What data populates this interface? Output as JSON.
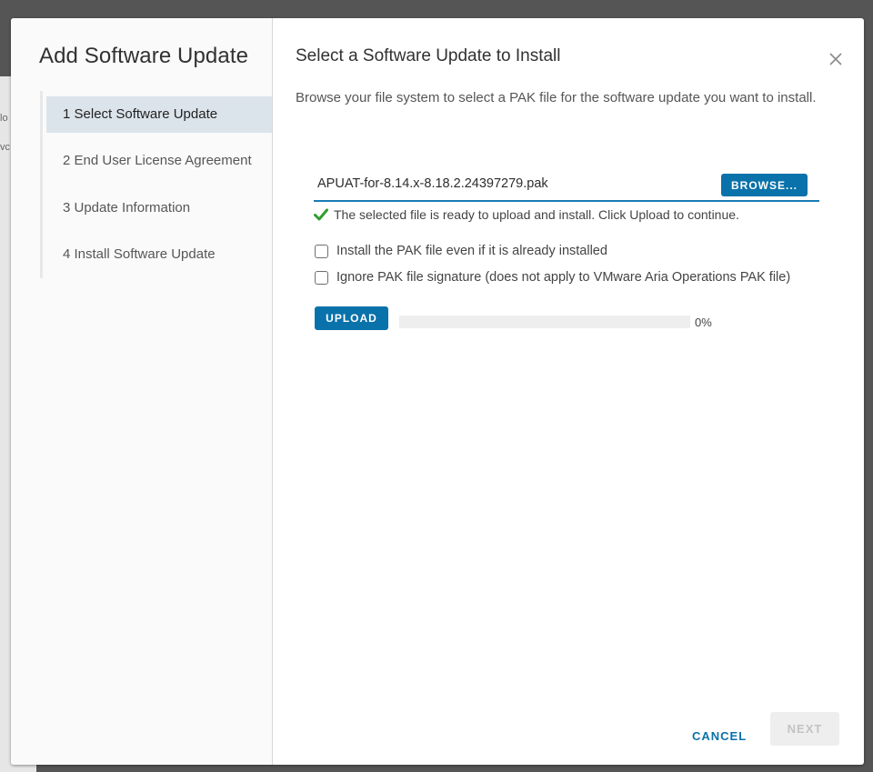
{
  "background": {
    "fragments": [
      "lo",
      "vc"
    ]
  },
  "wizard": {
    "title": "Add Software Update",
    "steps": [
      {
        "label": "1  Select Software Update",
        "active": true
      },
      {
        "label": "2  End User License Agreement",
        "active": false
      },
      {
        "label": "3  Update Information",
        "active": false
      },
      {
        "label": "4  Install Software Update",
        "active": false
      }
    ]
  },
  "content": {
    "title": "Select a Software Update to Install",
    "description": "Browse your file system to select a PAK file for the software update you want to install.",
    "file_input": {
      "value": "APUAT-for-8.14.x-8.18.2.24397279.pak",
      "browse_label": "BROWSE..."
    },
    "status_message": "The selected file is ready to upload and install. Click Upload to continue.",
    "status_icon": "check-icon",
    "status_color": "#2e9e2e",
    "options": [
      {
        "label": "Install the PAK file even if it is already installed",
        "checked": false
      },
      {
        "label": "Ignore PAK file signature (does not apply to VMware Aria Operations PAK file)",
        "checked": false
      }
    ],
    "upload_label": "UPLOAD",
    "progress": {
      "percent": 0,
      "label": "0%"
    }
  },
  "footer": {
    "cancel_label": "CANCEL",
    "next_label": "NEXT",
    "next_enabled": false
  },
  "colors": {
    "accent": "#0a72aa",
    "active_step_bg": "#dce4eb",
    "overlay": "#555555"
  }
}
